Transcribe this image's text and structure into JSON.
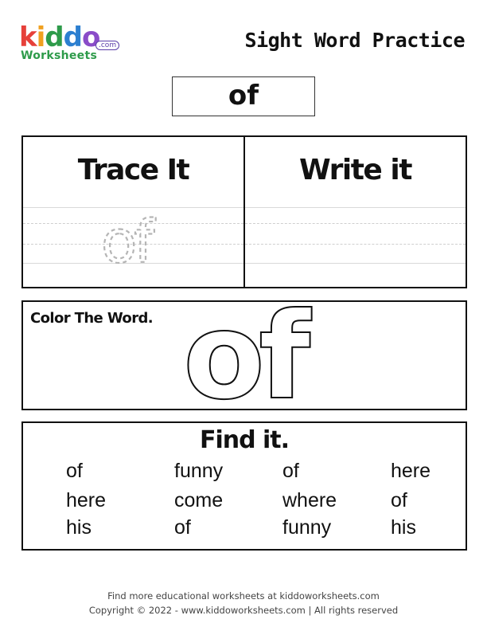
{
  "brand": {
    "letters": [
      {
        "ch": "k",
        "color": "#e6403a"
      },
      {
        "ch": "i",
        "color": "#f0a020"
      },
      {
        "ch": "d",
        "color": "#2e9b4a"
      },
      {
        "ch": "d",
        "color": "#2c7fd0"
      },
      {
        "ch": "o",
        "color": "#8a4cc8"
      }
    ],
    "sub": "Worksheets",
    "com": ".com"
  },
  "page_title": "Sight Word Practice",
  "sight_word": "of",
  "trace_section": {
    "trace_heading": "Trace It",
    "write_heading": "Write it",
    "trace_word": "of"
  },
  "color_section": {
    "label": "Color The Word.",
    "word": "of"
  },
  "find_section": {
    "heading": "Find it.",
    "rows": [
      [
        "of",
        "funny",
        "of",
        "here"
      ],
      [
        "here",
        "come",
        "where",
        "of"
      ],
      [
        "his",
        "of",
        "funny",
        "his"
      ]
    ]
  },
  "footer": {
    "line1": "Find more educational worksheets at kiddoworksheets.com",
    "line2": "Copyright © 2022 - www.kiddoworksheets.com  |  All rights reserved"
  }
}
